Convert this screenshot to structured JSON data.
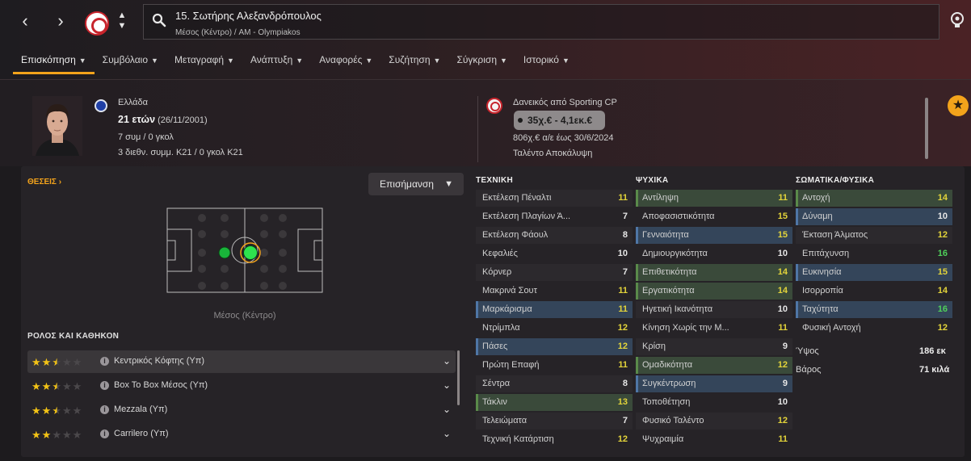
{
  "header": {
    "title": "15. Σωτήρης Αλεξανδρόπουλος",
    "subtitle": "Μέσος (Κέντρο) / AM - Olympiakos",
    "nav_back": "‹",
    "nav_forward": "›"
  },
  "tabs": [
    {
      "label": "Επισκόπηση",
      "active": true
    },
    {
      "label": "Συμβόλαιο"
    },
    {
      "label": "Μεταγραφή"
    },
    {
      "label": "Ανάπτυξη"
    },
    {
      "label": "Αναφορές"
    },
    {
      "label": "Συζήτηση"
    },
    {
      "label": "Σύγκριση"
    },
    {
      "label": "Ιστορικό"
    }
  ],
  "profile": {
    "nationality": "Ελλάδα",
    "age": "21 ετών",
    "dob": "(26/11/2001)",
    "caps": "7 συμ / 0 γκολ",
    "u21_caps": "3 διεθν. συμμ. Κ21 / 0 γκολ Κ21"
  },
  "loan": {
    "text": "Δανεικός από Sporting CP",
    "value": "35χ.€ - 4,1εκ.€",
    "wage": "806χ.€ α/ε έως 30/6/2024",
    "talent": "Ταλέντο Αποκάλυψη"
  },
  "positions": {
    "label": "ΘΕΣΕΙΣ",
    "chevron": "›",
    "highlight_label": "Επισήμανση",
    "position_name": "Μέσος (Κέντρο)"
  },
  "roles": {
    "title": "ΡΟΛΟΣ ΚΑΙ ΚΑΘΗΚΟΝ",
    "items": [
      {
        "label": "Κεντρικός Κόφτης (Υπ)",
        "stars": 2.5
      },
      {
        "label": "Box To Box Μέσος (Υπ)",
        "stars": 2.5
      },
      {
        "label": "Mezzala (Υπ)",
        "stars": 2.5
      },
      {
        "label": "Carrilero (Υπ)",
        "stars": 2
      }
    ]
  },
  "attributes": {
    "technical": {
      "title": "ΤΕΧΝΙΚΗ",
      "items": [
        {
          "label": "Εκτέλεση Πέναλτι",
          "value": "11",
          "hl": ""
        },
        {
          "label": "Εκτέλεση Πλαγίων Ά...",
          "value": "7",
          "hl": ""
        },
        {
          "label": "Εκτέλεση Φάουλ",
          "value": "8",
          "hl": ""
        },
        {
          "label": "Κεφαλιές",
          "value": "10",
          "hl": ""
        },
        {
          "label": "Κόρνερ",
          "value": "7",
          "hl": ""
        },
        {
          "label": "Μακρινά Σουτ",
          "value": "11",
          "hl": ""
        },
        {
          "label": "Μαρκάρισμα",
          "value": "11",
          "hl": "blue"
        },
        {
          "label": "Ντρίμπλα",
          "value": "12",
          "hl": ""
        },
        {
          "label": "Πάσες",
          "value": "12",
          "hl": "blue"
        },
        {
          "label": "Πρώτη Επαφή",
          "value": "11",
          "hl": ""
        },
        {
          "label": "Σέντρα",
          "value": "8",
          "hl": ""
        },
        {
          "label": "Τάκλιν",
          "value": "13",
          "hl": "green"
        },
        {
          "label": "Τελειώματα",
          "value": "7",
          "hl": ""
        },
        {
          "label": "Τεχνική Κατάρτιση",
          "value": "12",
          "hl": ""
        }
      ]
    },
    "mental": {
      "title": "ΨΥΧΙΚΑ",
      "items": [
        {
          "label": "Αντίληψη",
          "value": "11",
          "hl": "green"
        },
        {
          "label": "Αποφασιστικότητα",
          "value": "15",
          "hl": ""
        },
        {
          "label": "Γενναιότητα",
          "value": "15",
          "hl": "blue"
        },
        {
          "label": "Δημιουργικότητα",
          "value": "10",
          "hl": ""
        },
        {
          "label": "Επιθετικότητα",
          "value": "14",
          "hl": "green"
        },
        {
          "label": "Εργατικότητα",
          "value": "14",
          "hl": "green"
        },
        {
          "label": "Ηγετική Ικανότητα",
          "value": "10",
          "hl": ""
        },
        {
          "label": "Κίνηση Χωρίς την Μ...",
          "value": "11",
          "hl": ""
        },
        {
          "label": "Κρίση",
          "value": "9",
          "hl": ""
        },
        {
          "label": "Ομαδικότητα",
          "value": "12",
          "hl": "green"
        },
        {
          "label": "Συγκέντρωση",
          "value": "9",
          "hl": "blue"
        },
        {
          "label": "Τοποθέτηση",
          "value": "10",
          "hl": ""
        },
        {
          "label": "Φυσικό Ταλέντο",
          "value": "12",
          "hl": ""
        },
        {
          "label": "Ψυχραιμία",
          "value": "11",
          "hl": ""
        }
      ]
    },
    "physical": {
      "title": "ΣΩΜΑΤΙΚΑ/ΦΥΣΙΚΑ",
      "items": [
        {
          "label": "Αντοχή",
          "value": "14",
          "hl": "green"
        },
        {
          "label": "Δύναμη",
          "value": "10",
          "hl": "blue"
        },
        {
          "label": "Έκταση Άλματος",
          "value": "12",
          "hl": ""
        },
        {
          "label": "Επιτάχυνση",
          "value": "16",
          "hl": ""
        },
        {
          "label": "Ευκινησία",
          "value": "15",
          "hl": "blue"
        },
        {
          "label": "Ισορροπία",
          "value": "14",
          "hl": ""
        },
        {
          "label": "Ταχύτητα",
          "value": "16",
          "hl": "blue"
        },
        {
          "label": "Φυσική Αντοχή",
          "value": "12",
          "hl": ""
        }
      ],
      "height_label": "Ύψος",
      "height_value": "186 εκ",
      "weight_label": "Βάρος",
      "weight_value": "71 κιλά"
    }
  },
  "colors": {
    "accent": "#f3a31b",
    "attr_white": "#e6e6e6",
    "attr_yellow": "#e3d43a",
    "attr_green": "#4fd05a"
  }
}
